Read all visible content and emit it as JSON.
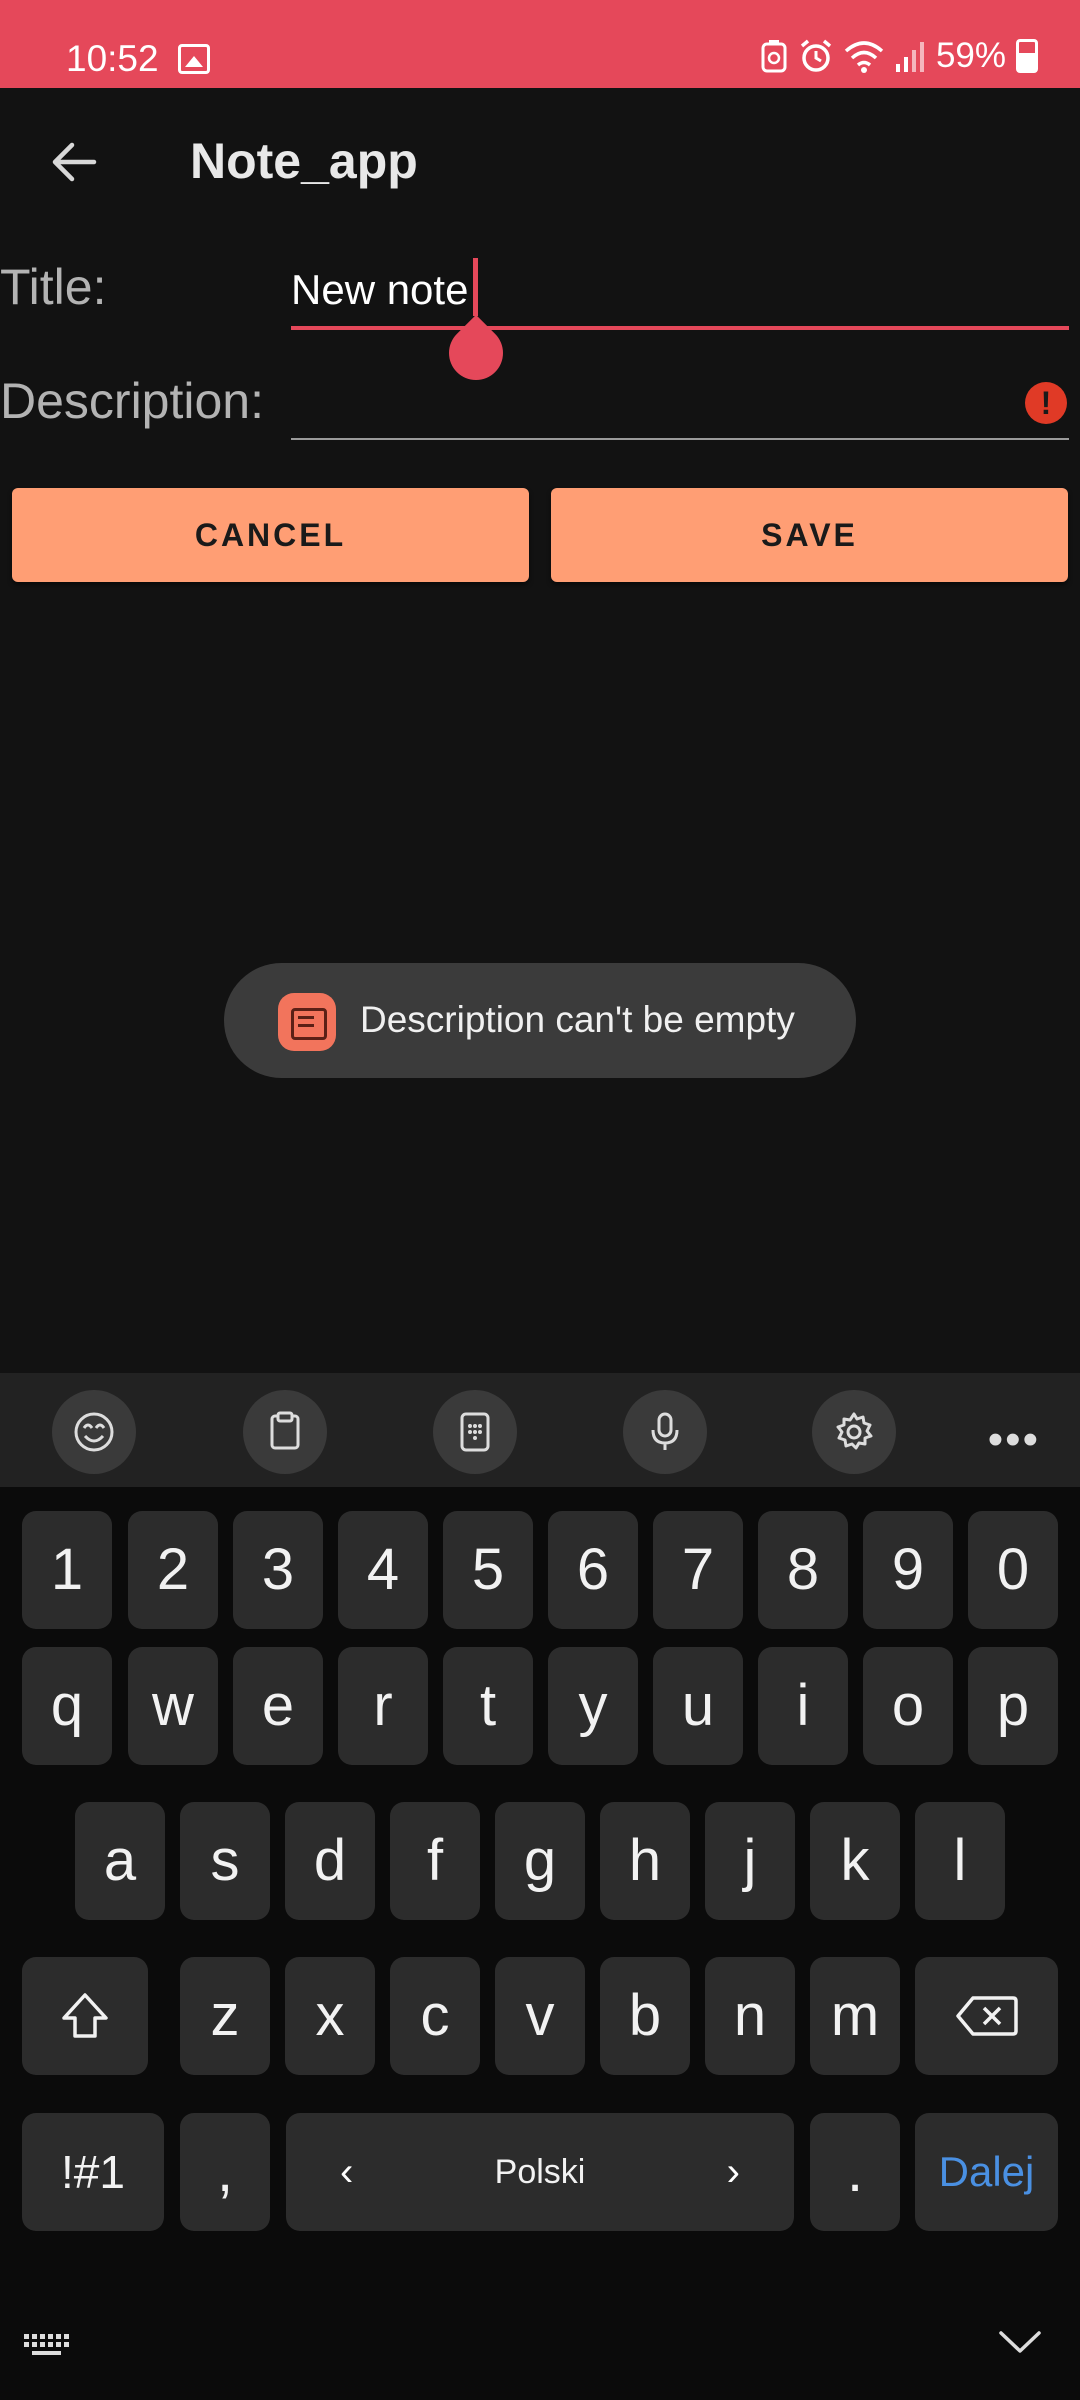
{
  "status_bar": {
    "time": "10:52",
    "battery": "59%"
  },
  "app_bar": {
    "title": "Note_app"
  },
  "form": {
    "title_label": "Title:",
    "title_value": "New note",
    "description_label": "Description:",
    "description_value": ""
  },
  "buttons": {
    "cancel": "CANCEL",
    "save": "SAVE"
  },
  "toast": {
    "message": "Description can't be empty"
  },
  "keyboard": {
    "number_row": [
      "1",
      "2",
      "3",
      "4",
      "5",
      "6",
      "7",
      "8",
      "9",
      "0"
    ],
    "row1": [
      "q",
      "w",
      "e",
      "r",
      "t",
      "y",
      "u",
      "i",
      "o",
      "p"
    ],
    "row2": [
      "a",
      "s",
      "d",
      "f",
      "g",
      "h",
      "j",
      "k",
      "l"
    ],
    "row3": [
      "z",
      "x",
      "c",
      "v",
      "b",
      "n",
      "m"
    ],
    "symbols_key": "!#1",
    "comma_key": ",",
    "space_label": "Polski",
    "period_key": ".",
    "action_key": "Dalej"
  },
  "colors": {
    "accent": "#e5485a",
    "button": "#ff9e74",
    "background": "#121212",
    "error": "#e03a26",
    "action_key": "#4a90e2"
  }
}
